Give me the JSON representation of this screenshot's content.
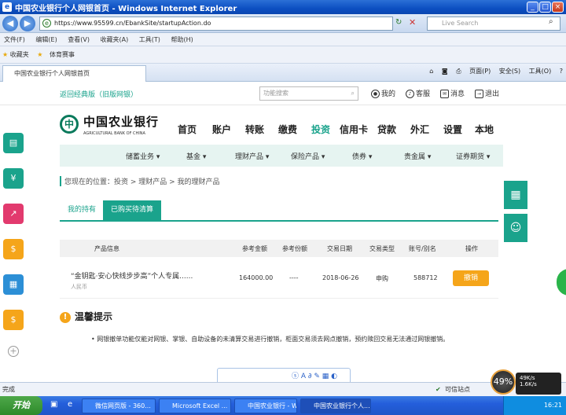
{
  "window": {
    "title": "中国农业银行个人网银首页 - Windows Internet Explorer"
  },
  "address": {
    "url": "https://www.95599.cn/EbankSite/startupAction.do",
    "search_placeholder": "Live Search"
  },
  "menu": [
    "文件(F)",
    "编辑(E)",
    "查看(V)",
    "收藏夹(A)",
    "工具(T)",
    "帮助(H)"
  ],
  "favorites": {
    "label": "收藏夹",
    "item": "体育赛事"
  },
  "tab": {
    "label": "中国农业银行个人网银首页"
  },
  "commands": {
    "page": "页面(P)",
    "safety": "安全(S)",
    "tools": "工具(O)"
  },
  "site": {
    "classic_link": "返回经典版（旧版网银）",
    "search_placeholder": "功能搜索",
    "my": "我的",
    "service": "客服",
    "message": "消息",
    "logout": "退出",
    "logo_cn": "中国农业银行",
    "logo_en": "AGRICULTURAL BANK OF CHINA"
  },
  "mainnav": [
    "首页",
    "账户",
    "转账",
    "缴费",
    "投资",
    "信用卡",
    "贷款",
    "外汇",
    "设置",
    "本地"
  ],
  "subnav": [
    "储蓄业务",
    "基金",
    "理财产品",
    "保险产品",
    "债券",
    "贵金属",
    "证券期货"
  ],
  "breadcrumb": "您现在的位置：投资 > 理财产品 > 我的理财产品",
  "tabs": {
    "my_holdings": "我的持有",
    "purchased_pending": "已购买待清算"
  },
  "table": {
    "headers": [
      "产品信息",
      "参考金额",
      "参考份额",
      "交易日期",
      "交易类型",
      "账号/别名",
      "操作"
    ],
    "row": {
      "product": "“金钥匙·安心快线步步高”个人专属......",
      "currency": "人民币",
      "amount": "164000.00",
      "shares": "----",
      "date": "2018-06-26",
      "type": "申购",
      "account": "588712",
      "action": "撤销"
    }
  },
  "tip": {
    "title": "温馨提示",
    "text": "• 网银撤单功能仅能对网银、掌银、自助设备的未清算交易进行撤销，柜面交易须去网点撤销，预约赎回交易无法通过网银撤销。"
  },
  "status": {
    "left": "完成",
    "zone": "可信站点"
  },
  "perf": {
    "percent": "49%",
    "upload": "49K/s",
    "download": "1.6K/s"
  },
  "taskbar": {
    "start": "开始",
    "tasks": [
      "微信网页版 - 360...",
      "Microsoft Excel ...",
      "中国农业银行 - W...",
      "中国农业银行个人..."
    ],
    "clock": "16:21"
  },
  "colors": {
    "accent": "#1aa38c",
    "orange": "#f5a51a"
  }
}
